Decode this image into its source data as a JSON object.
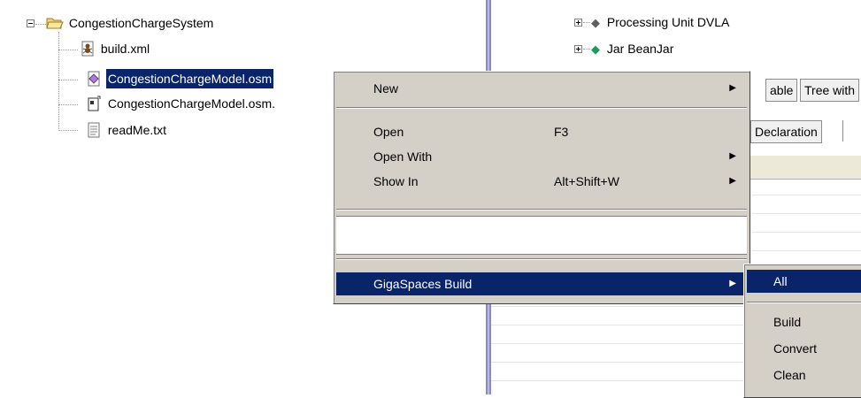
{
  "left_tree": {
    "project": "CongestionChargeSystem",
    "files": [
      {
        "label": "build.xml",
        "icon": "ant-build-file-icon"
      },
      {
        "label": "CongestionChargeModel.osm",
        "icon": "model-file-icon"
      },
      {
        "label": "CongestionChargeModel.osm.",
        "icon": "diagram-file-icon"
      },
      {
        "label": "readMe.txt",
        "icon": "text-file-icon"
      }
    ]
  },
  "right_tree": {
    "items": [
      {
        "label": "Processing Unit DVLA"
      },
      {
        "label": "Jar BeanJar"
      }
    ]
  },
  "right_tabs": {
    "tab1": "able",
    "tab2": "Tree with",
    "tab3": "Declaration"
  },
  "context_menu": {
    "new": "New",
    "open": "Open",
    "open_shortcut": "F3",
    "open_with": "Open With",
    "show_in": "Show In",
    "show_in_shortcut": "Alt+Shift+W",
    "gigaspaces_build": "GigaSpaces Build"
  },
  "submenu": {
    "all": "All",
    "build": "Build",
    "convert": "Convert",
    "clean": "Clean"
  },
  "colors": {
    "selection": "#0a246a",
    "menu_bg": "#d4d0c8",
    "splitter": "#8c8cc8"
  }
}
